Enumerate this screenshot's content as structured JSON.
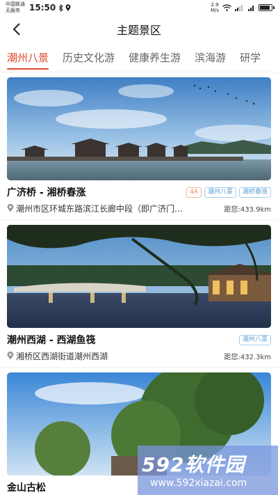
{
  "status_bar": {
    "carrier_line1": "中国联通",
    "carrier_line2": "无服务",
    "time": "15:50",
    "net_speed_value": "2.9",
    "net_speed_unit": "M/s",
    "battery_level": 0.85
  },
  "header": {
    "title": "主题景区",
    "back_icon": "chevron-left-icon"
  },
  "tabs": [
    {
      "label": "潮州八景",
      "active": true
    },
    {
      "label": "历史文化游",
      "active": false
    },
    {
      "label": "健康养生游",
      "active": false
    },
    {
      "label": "滨海游",
      "active": false
    },
    {
      "label": "研学",
      "active": false
    }
  ],
  "cards": [
    {
      "title": "广济桥 - 湘桥春涨",
      "tags": [
        "4A",
        "潮州八景",
        "湘桥春涨"
      ],
      "address": "潮州市区环城东路滨江长廊中段（即广济门...",
      "distance": "距您:433.9km"
    },
    {
      "title": "潮州西湖 - 西湖鱼筏",
      "tags": [
        "潮州八景"
      ],
      "address": "湘桥区西湖街道潮州西湖",
      "distance": "距您:432.3km"
    },
    {
      "title": "金山古松",
      "tags": [],
      "address": "",
      "distance": ""
    }
  ],
  "watermark": {
    "logo": "592软件园",
    "url": "www.592xiazai.com"
  },
  "colors": {
    "accent": "#e2452b",
    "tag_orange": "#f08a5a",
    "tag_blue": "#5aa0d8"
  }
}
